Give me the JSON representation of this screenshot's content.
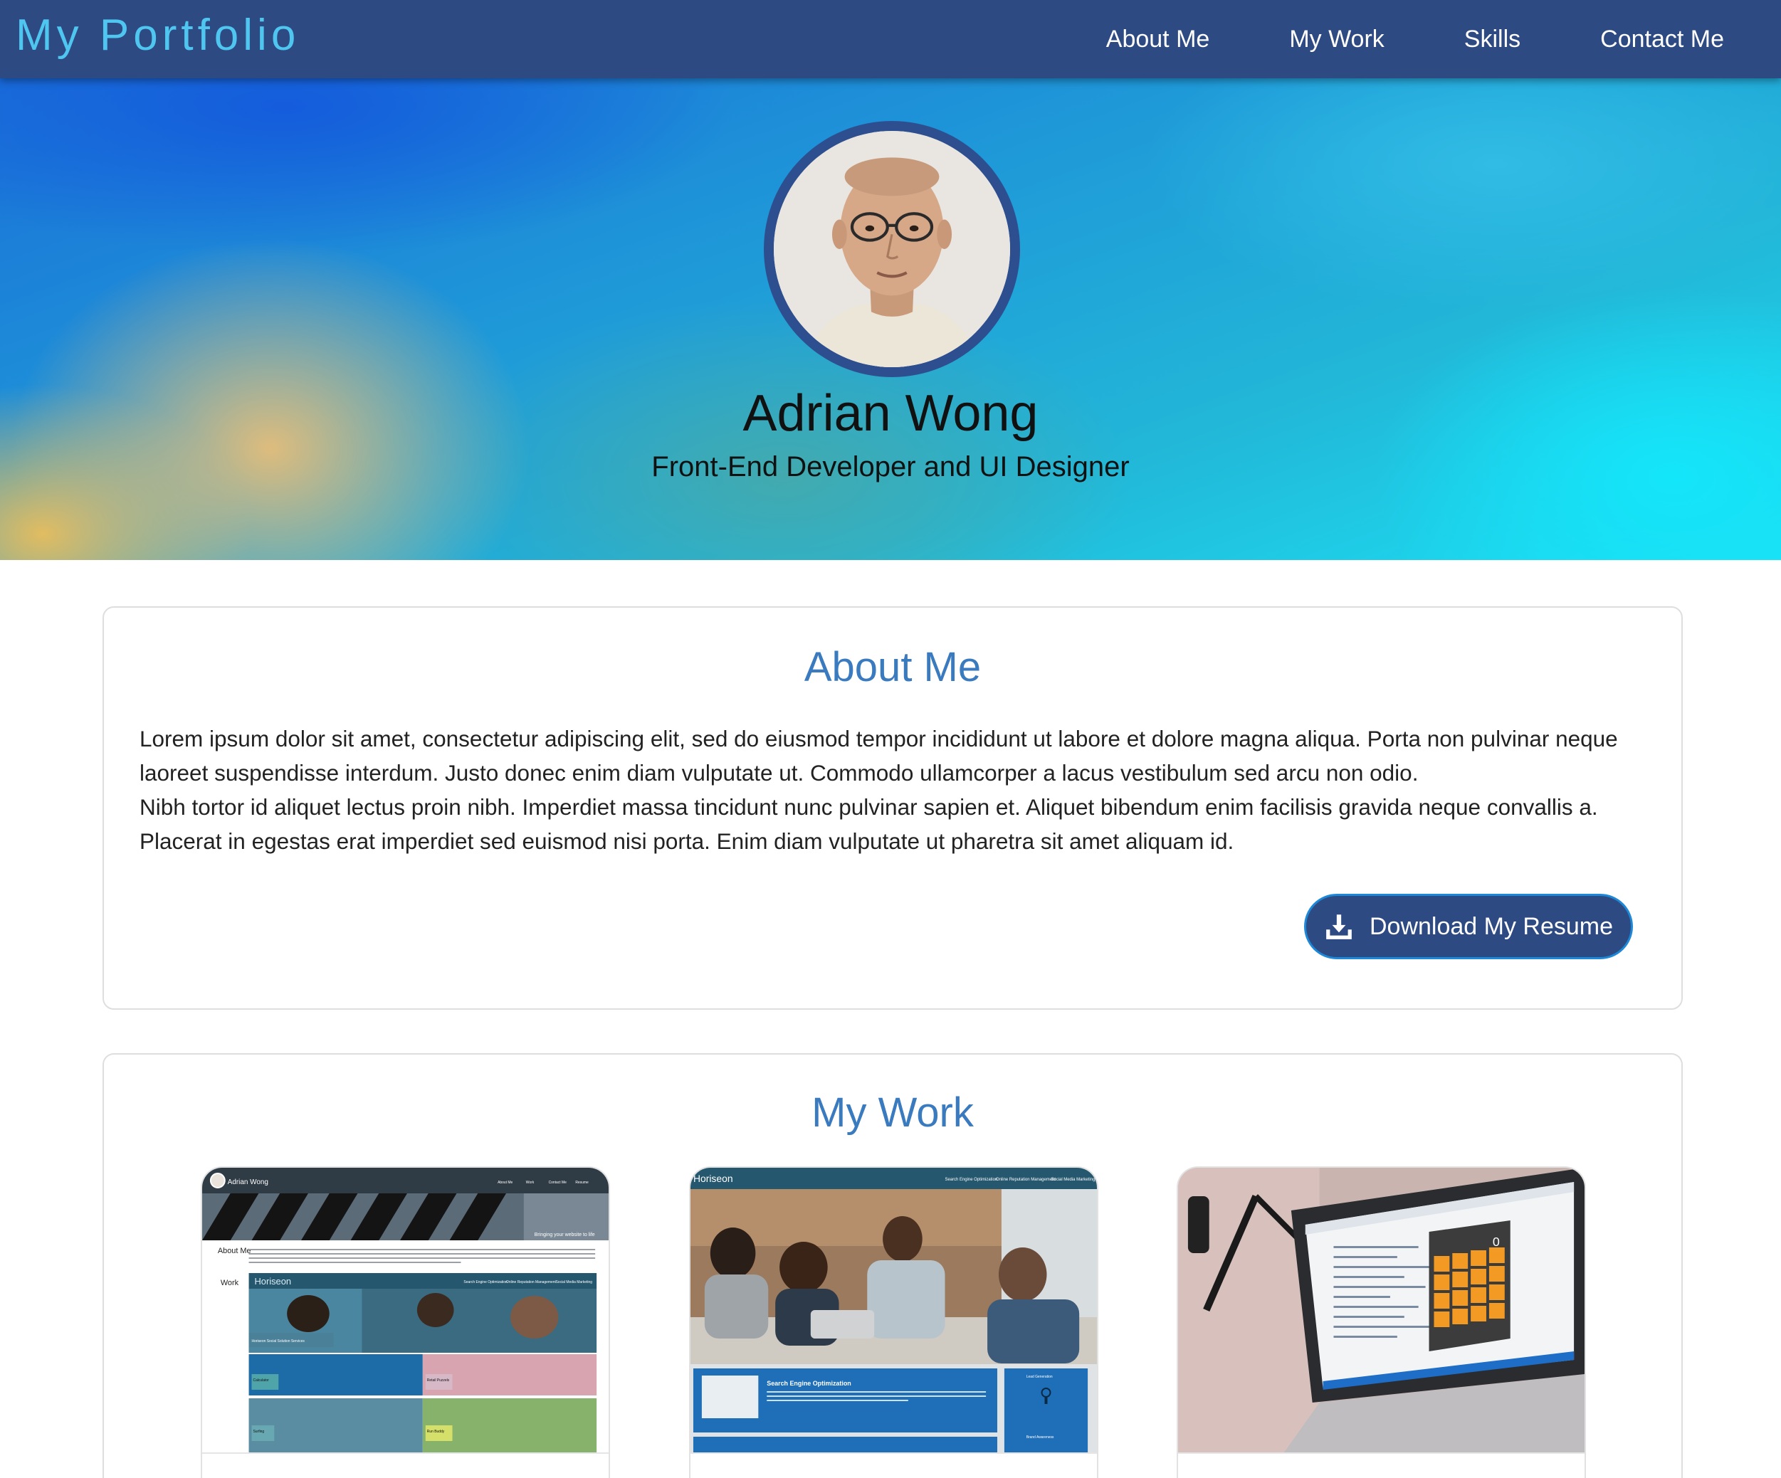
{
  "navbar": {
    "brand": "My Portfolio",
    "links": [
      "About Me",
      "My Work",
      "Skills",
      "Contact Me"
    ]
  },
  "hero": {
    "name": "Adrian Wong",
    "subtitle": "Front-End Developer and UI Designer",
    "avatar_icon": "profile-photo"
  },
  "about": {
    "title": "About Me",
    "paragraphs": [
      "Lorem ipsum dolor sit amet, consectetur adipiscing elit, sed do eiusmod tempor incididunt ut labore et dolore magna aliqua. Porta non pulvinar neque laoreet suspendisse interdum. Justo donec enim diam vulputate ut. Commodo ullamcorper a lacus vestibulum sed arcu non odio.",
      "Nibh tortor id aliquet lectus proin nibh. Imperdiet massa tincidunt nunc pulvinar sapien et. Aliquet bibendum enim facilisis gravida neque convallis a. Placerat in egestas erat imperdiet sed euismod nisi porta. Enim diam vulputate ut pharetra sit amet aliquam id."
    ],
    "download_label": "Download My Resume",
    "download_icon": "download-icon"
  },
  "work": {
    "title": "My Work",
    "projects": [
      {
        "thumb_header": "Adrian Wong",
        "thumb_nav": [
          "About Me",
          "Work",
          "Contact Me",
          "Resume"
        ],
        "thumb_tagline": "Bringing your website to life",
        "thumb_side": [
          "About Me",
          "Work"
        ],
        "thumb_inner_brand": "Horiseon",
        "thumb_inner_nav": [
          "Search Engine Optimization",
          "Online Reputation Management",
          "Social Media Marketing"
        ],
        "thumb_tiles": [
          "Horiseon Social Solution Services",
          "Calculator",
          "Retail Puzzels",
          "Surfing",
          "Run Buddy"
        ]
      },
      {
        "thumb_header": "Horiseon",
        "thumb_nav": [
          "Search Engine Optimization",
          "Online Reputation Management",
          "Social Media Marketing"
        ],
        "thumb_section": "Search Engine Optimization",
        "thumb_sidebar": [
          "Lead Generation",
          "Brand Awareness"
        ]
      },
      {
        "thumb_display": "0"
      }
    ]
  },
  "colors": {
    "navbar": "#2d4a82",
    "brand": "#4fc6f0",
    "heading": "#3a7abf",
    "button": "#2d4a82",
    "button_border": "#1e88d8"
  }
}
